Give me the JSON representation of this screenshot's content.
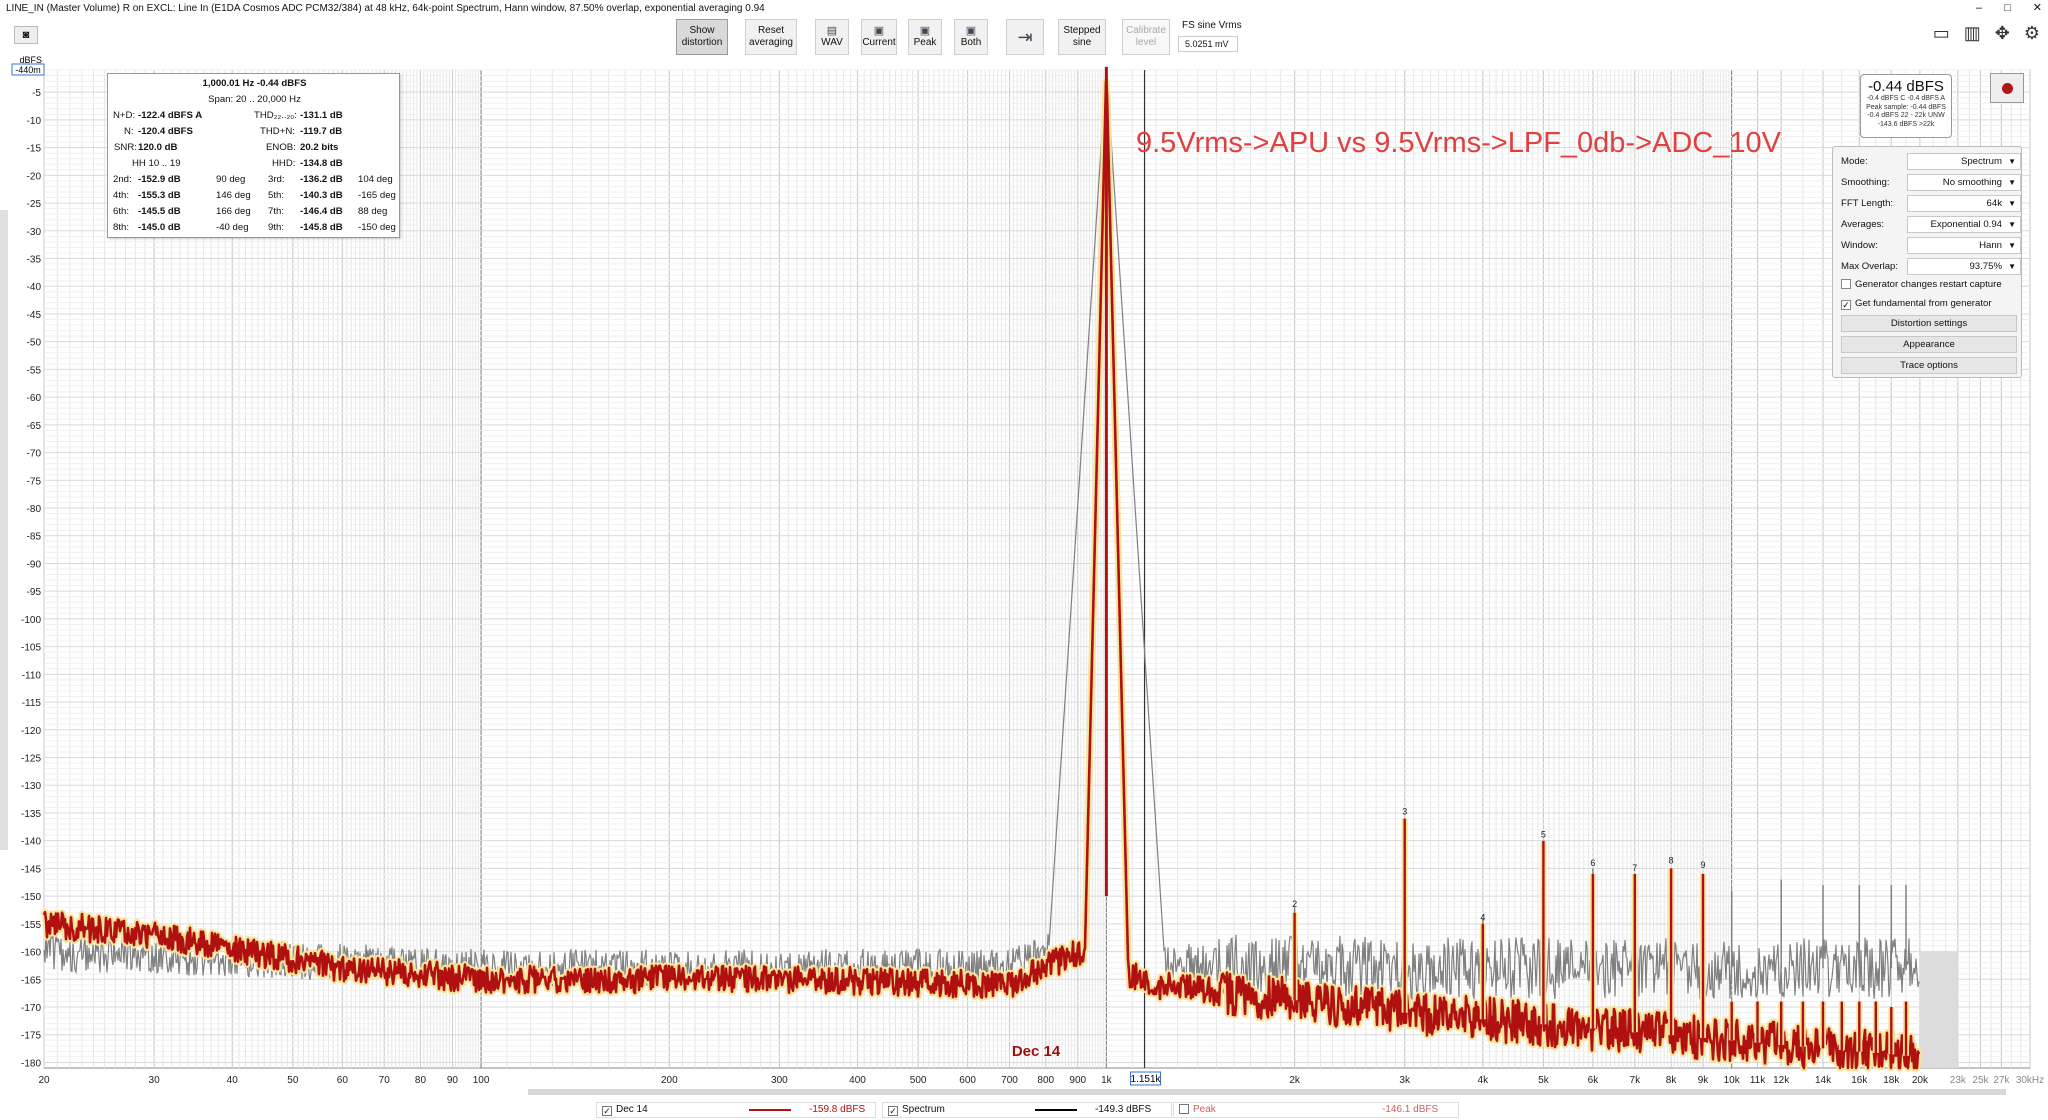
{
  "window": {
    "title": "LINE_IN (Master Volume) R on EXCL: Line In (E1DA Cosmos ADC PCM32/384) at 48 kHz, 64k-point Spectrum, Hann window, 87.50% overlap, exponential averaging 0.94",
    "controls": [
      "–",
      "□",
      "✕"
    ]
  },
  "toolbar": {
    "show_distortion": "Show distortion",
    "reset_averaging": "Reset averaging",
    "wav": "WAV",
    "current": "Current",
    "peak": "Peak",
    "both": "Both",
    "stepped_sine": "Stepped sine",
    "calibrate_level": "Calibrate level",
    "fs_label": "FS sine Vrms",
    "fs_value": "5.0251 mV"
  },
  "stats": {
    "header": "1,000.01 Hz  -0.44 dBFS",
    "span": "Span: 20 .. 20,000 Hz",
    "nd_l": "N+D:",
    "nd_v": "-122.4 dBFS A",
    "thd_l": "THD₂₂..₂₀:",
    "thd_v": "-131.1 dB",
    "n_l": "N:",
    "n_v": "-120.4 dBFS",
    "thdn_l": "THD+N:",
    "thdn_v": "-119.7 dB",
    "snr_l": "SNR:",
    "snr_v": "120.0 dB",
    "enob_l": "ENOB:",
    "enob_v": "20.2 bits",
    "hh": "HH 10 .. 19",
    "hhd_l": "HHD:",
    "hhd_v": "-134.8 dB",
    "harm": [
      {
        "l1": "2nd:",
        "v1": "-152.9 dB",
        "d1": "90 deg",
        "l2": "3rd:",
        "v2": "-136.2 dB",
        "d2": "104 deg"
      },
      {
        "l1": "4th:",
        "v1": "-155.3 dB",
        "d1": "146 deg",
        "l2": "5th:",
        "v2": "-140.3 dB",
        "d2": "-165 deg"
      },
      {
        "l1": "6th:",
        "v1": "-145.5 dB",
        "d1": "166 deg",
        "l2": "7th:",
        "v2": "-146.4 dB",
        "d2": "88 deg"
      },
      {
        "l1": "8th:",
        "v1": "-145.0 dB",
        "d1": "-40 deg",
        "l2": "9th:",
        "v2": "-145.8 dB",
        "d2": "-150 deg"
      }
    ]
  },
  "annotation": "9.5Vrms->APU vs 9.5Vrms->LPF_0db->ADC_10V",
  "trace_label": "Dec 14",
  "level": {
    "big": "-0.44 dBFS",
    "lines": [
      "-0.4 dBFS C  -0.4 dBFS A",
      "Peak sample: -0.44 dBFS",
      "-0.4 dBFS 22 - 22k UNW",
      "-143.6 dBFS >22k"
    ]
  },
  "settings": {
    "rows": [
      {
        "label": "Mode:",
        "value": "Spectrum"
      },
      {
        "label": "Smoothing:",
        "value": "No smoothing"
      },
      {
        "label": "FFT Length:",
        "value": "64k"
      },
      {
        "label": "Averages:",
        "value": "Exponential 0.94"
      },
      {
        "label": "Window:",
        "value": "Hann"
      },
      {
        "label": "Max Overlap:",
        "value": "93.75%"
      }
    ],
    "gen_restart": "Generator changes restart capture",
    "gen_restart_checked": false,
    "get_fund": "Get fundamental from generator",
    "get_fund_checked": true,
    "btn_dist": "Distortion settings",
    "btn_app": "Appearance",
    "btn_trace": "Trace options"
  },
  "axis": {
    "y_unit": "dBFS",
    "y_top_box": "-440m",
    "cursor_freq": "1.151k",
    "y_ticks": [
      "-5",
      "-10",
      "-15",
      "-20",
      "-25",
      "-30",
      "-35",
      "-40",
      "-45",
      "-50",
      "-55",
      "-60",
      "-65",
      "-70",
      "-75",
      "-80",
      "-85",
      "-90",
      "-95",
      "-100",
      "-105",
      "-110",
      "-115",
      "-120",
      "-125",
      "-130",
      "-135",
      "-140",
      "-145",
      "-150",
      "-155",
      "-160",
      "-165",
      "-170",
      "-175",
      "-180"
    ],
    "x_ticks": [
      [
        "20",
        20
      ],
      [
        "30",
        30
      ],
      [
        "40",
        40
      ],
      [
        "50",
        50
      ],
      [
        "60",
        60
      ],
      [
        "70",
        70
      ],
      [
        "80",
        80
      ],
      [
        "90",
        90
      ],
      [
        "100",
        100
      ],
      [
        "200",
        200
      ],
      [
        "300",
        300
      ],
      [
        "400",
        400
      ],
      [
        "500",
        500
      ],
      [
        "600",
        600
      ],
      [
        "700",
        700
      ],
      [
        "800",
        800
      ],
      [
        "900",
        900
      ],
      [
        "1k",
        1000
      ],
      [
        "2k",
        2000
      ],
      [
        "3k",
        3000
      ],
      [
        "4k",
        4000
      ],
      [
        "5k",
        5000
      ],
      [
        "6k",
        6000
      ],
      [
        "7k",
        7000
      ],
      [
        "8k",
        8000
      ],
      [
        "9k",
        9000
      ],
      [
        "10k",
        10000
      ],
      [
        "11k",
        11000
      ],
      [
        "12k",
        12000
      ],
      [
        "14k",
        14000
      ],
      [
        "16k",
        16000
      ],
      [
        "18k",
        18000
      ],
      [
        "20k",
        20000
      ],
      [
        "23k",
        23000
      ],
      [
        "25k",
        25000
      ],
      [
        "27k",
        27000
      ],
      [
        "30kHz",
        30000
      ]
    ]
  },
  "chart_data": {
    "type": "line",
    "xscale": "log",
    "xlim": [
      20,
      30000
    ],
    "ylim": [
      -181,
      -1
    ],
    "ylabel": "dBFS",
    "harmonic_labels": [
      {
        "n": "2",
        "f": 2000,
        "db": -152.9
      },
      {
        "n": "3",
        "f": 3000,
        "db": -136.2
      },
      {
        "n": "4",
        "f": 4000,
        "db": -155.3
      },
      {
        "n": "5",
        "f": 5000,
        "db": -140.3
      },
      {
        "n": "6",
        "f": 6000,
        "db": -145.5
      },
      {
        "n": "7",
        "f": 7000,
        "db": -146.4
      },
      {
        "n": "8",
        "f": 8000,
        "db": -145.0
      },
      {
        "n": "9",
        "f": 9000,
        "db": -145.8
      }
    ],
    "series": [
      {
        "name": "Dec 14",
        "color": "#b01010",
        "fundamental": {
          "f": 1000,
          "db": -0.44
        },
        "noise_floor": [
          [
            20,
            -155
          ],
          [
            30,
            -157
          ],
          [
            60,
            -163
          ],
          [
            100,
            -165
          ],
          [
            300,
            -165
          ],
          [
            700,
            -166
          ],
          [
            900,
            -160
          ],
          [
            1200,
            -166
          ],
          [
            3000,
            -171
          ],
          [
            10000,
            -176
          ],
          [
            20000,
            -179
          ]
        ],
        "spurs": [
          [
            2000,
            -153
          ],
          [
            3000,
            -136
          ],
          [
            4000,
            -155
          ],
          [
            5000,
            -140
          ],
          [
            6000,
            -146
          ],
          [
            7000,
            -146
          ],
          [
            8000,
            -145
          ],
          [
            9000,
            -146
          ],
          [
            10000,
            -169
          ],
          [
            11000,
            -169
          ],
          [
            12000,
            -169
          ],
          [
            13000,
            -169
          ],
          [
            14000,
            -169
          ],
          [
            15000,
            -169
          ],
          [
            16000,
            -169
          ],
          [
            17000,
            -169
          ],
          [
            18000,
            -170
          ],
          [
            19000,
            -169
          ]
        ]
      },
      {
        "name": "Spectrum",
        "color": "#808080",
        "fundamental": {
          "f": 1000,
          "db": -0.44
        },
        "noise_floor": [
          [
            20,
            -160
          ],
          [
            100,
            -163
          ],
          [
            300,
            -163
          ],
          [
            700,
            -163
          ],
          [
            900,
            -158
          ],
          [
            1200,
            -162
          ],
          [
            3000,
            -163
          ],
          [
            20000,
            -163
          ]
        ],
        "spurs": [
          [
            2000,
            -152
          ],
          [
            3000,
            -136
          ],
          [
            4000,
            -154
          ],
          [
            5000,
            -140
          ],
          [
            6000,
            -145
          ],
          [
            7000,
            -146
          ],
          [
            8000,
            -145
          ],
          [
            9000,
            -146
          ],
          [
            10000,
            -149
          ],
          [
            12000,
            -147
          ],
          [
            14000,
            -148
          ],
          [
            16000,
            -148
          ],
          [
            18000,
            -148
          ],
          [
            19000,
            -148
          ]
        ]
      }
    ]
  },
  "status": {
    "dec_name": "Dec 14",
    "dec_value": "-159.8 dBFS",
    "spec_name": "Spectrum",
    "spec_value": "-149.3 dBFS",
    "peak_name": "Peak",
    "peak_value": "-146.1 dBFS"
  },
  "colors": {
    "trace_main": "#b01010",
    "trace_glow": "#f7e39a",
    "trace_ref": "#808080",
    "annot": "#e04040"
  }
}
